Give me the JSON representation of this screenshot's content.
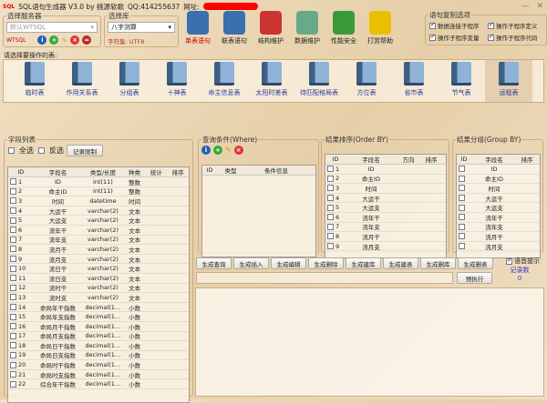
{
  "title": {
    "logo": "SQL",
    "app": "SQL语句生成器 V3.0 by 桃源软歌",
    "qq": "QQ:414255637",
    "site_label": "网址:"
  },
  "server": {
    "legend": "选择服务器",
    "value": "默认WTSQL",
    "tag": "WTSQL"
  },
  "database": {
    "legend": "选择库",
    "value": "八字测算",
    "charset": "字符集: UTF8"
  },
  "toolbar": [
    {
      "label": "单表语句",
      "color": "#3a6fb0"
    },
    {
      "label": "联表语句",
      "color": "#3a6fb0"
    },
    {
      "label": "结构维护",
      "color": "#c33"
    },
    {
      "label": "数据维护",
      "color": "#6a8"
    },
    {
      "label": "性能安全",
      "color": "#3a9a3a"
    },
    {
      "label": "打赏帮助",
      "color": "#e8c000"
    }
  ],
  "options": {
    "legend": "语句复制选项",
    "items": [
      {
        "label": "数据连接子程序",
        "checked": true
      },
      {
        "label": "操作子程序定义",
        "checked": true
      },
      {
        "label": "操作子程序变量",
        "checked": true
      },
      {
        "label": "操作子程序代码",
        "checked": true
      }
    ]
  },
  "tables_label": "请选择要操作的表:",
  "tables": [
    "临时表",
    "作用关系表",
    "分组表",
    "十神表",
    "命主信息表",
    "太阳时差表",
    "待匹配格局表",
    "方位表",
    "省市表",
    "节气表",
    "运程表"
  ],
  "fields": {
    "legend": "字段列表",
    "select_all": "全选",
    "invert": "反选",
    "limit_btn": "记录限制",
    "headers": [
      "ID",
      "字段名",
      "类型/长度",
      "种类",
      "统计",
      "排序"
    ],
    "rows": [
      [
        "1",
        "ID",
        "int(11)",
        "整数"
      ],
      [
        "2",
        "命主ID",
        "int(11)",
        "整数"
      ],
      [
        "3",
        "时间",
        "datetime",
        "时间"
      ],
      [
        "4",
        "大运干",
        "varchar(2)",
        "文本"
      ],
      [
        "5",
        "大运支",
        "varchar(2)",
        "文本"
      ],
      [
        "6",
        "流年干",
        "varchar(2)",
        "文本"
      ],
      [
        "7",
        "流年支",
        "varchar(2)",
        "文本"
      ],
      [
        "8",
        "流月干",
        "varchar(2)",
        "文本"
      ],
      [
        "9",
        "流月支",
        "varchar(2)",
        "文本"
      ],
      [
        "10",
        "流日干",
        "varchar(2)",
        "文本"
      ],
      [
        "11",
        "流日支",
        "varchar(2)",
        "文本"
      ],
      [
        "12",
        "流时干",
        "varchar(2)",
        "文本"
      ],
      [
        "13",
        "流时支",
        "varchar(2)",
        "文本"
      ],
      [
        "14",
        "命局年干指数",
        "decimal(1…",
        "小数"
      ],
      [
        "15",
        "命局年支指数",
        "decimal(1…",
        "小数"
      ],
      [
        "16",
        "命局月干指数",
        "decimal(1…",
        "小数"
      ],
      [
        "17",
        "命局月支指数",
        "decimal(1…",
        "小数"
      ],
      [
        "18",
        "命局日干指数",
        "decimal(1…",
        "小数"
      ],
      [
        "19",
        "命局日支指数",
        "decimal(1…",
        "小数"
      ],
      [
        "20",
        "命局时干指数",
        "decimal(1…",
        "小数"
      ],
      [
        "21",
        "命局时支指数",
        "decimal(1…",
        "小数"
      ],
      [
        "22",
        "综合年干指数",
        "decimal(1…",
        "小数"
      ]
    ]
  },
  "where": {
    "legend": "查询条件(Where)",
    "headers": [
      "ID",
      "类型",
      "条件信息"
    ]
  },
  "order": {
    "legend": "结果排序(Order BY)",
    "headers": [
      "ID",
      "字段名",
      "方向",
      "排序"
    ],
    "rows": [
      "ID",
      "命主ID",
      "时间",
      "大运干",
      "大运支",
      "流年干",
      "流年支",
      "流月干",
      "流月支"
    ]
  },
  "group": {
    "legend": "结果分组(Group BY)",
    "headers": [
      "ID",
      "字段名",
      "排序"
    ],
    "rows": [
      "ID",
      "命主ID",
      "时间",
      "大运干",
      "大运支",
      "流年干",
      "流年支",
      "流月干",
      "流月支"
    ]
  },
  "actions": [
    "生成查询",
    "生成插入",
    "生成编辑",
    "生成删除",
    "生成建库",
    "生成建表",
    "生成删库",
    "生成删表"
  ],
  "voice": {
    "label": "语音提示",
    "checked": true
  },
  "records": {
    "label": "记录数",
    "value": "0"
  },
  "sql_input": "",
  "preexec": "预执行"
}
